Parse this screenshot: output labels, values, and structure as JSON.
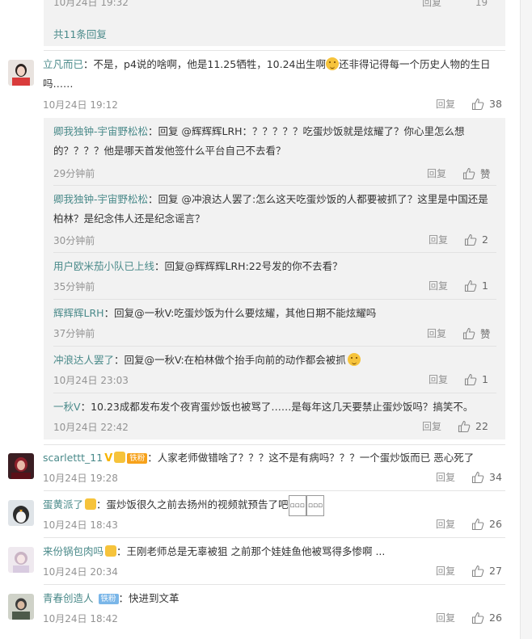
{
  "prev_thread": {
    "cut_time": "10月24日 19:32",
    "cut_reply": "回复",
    "cut_likes": "19",
    "more_replies": "共11条回复"
  },
  "comments": [
    {
      "name": "立凡而已",
      "text_a": "：不是，p4说的啥啊，他是11.25牺牲，10.24出生啊",
      "text_b": "还非得记得每一个历史人物的生日吗……",
      "time": "10月24日 19:12",
      "reply": "回复",
      "likes": "38",
      "replies": [
        {
          "name": "卿我独钟-宇宙野松松",
          "text": "：回复 @辉辉辉LRH：？？？？？吃蛋炒饭就是炫耀了？你心里怎么想的？？？？他是哪天首发他签什么平台自己不去看？",
          "time": "29分钟前",
          "reply": "回复",
          "likes": "赞"
        },
        {
          "name": "卿我独钟-宇宙野松松",
          "text": "：回复 @冲浪达人罢了:怎么这天吃蛋炒饭的人都要被抓了？这里是中国还是柏林？是纪念伟人还是纪念谣言？",
          "time": "30分钟前",
          "reply": "回复",
          "likes": "2"
        },
        {
          "name": "用户欧米茄小队已上线",
          "text": "：回复@辉辉辉LRH:22号发的你不去看？",
          "time": "35分钟前",
          "reply": "回复",
          "likes": "1"
        },
        {
          "name": "辉辉辉LRH",
          "text": "：回复@一秋V:吃蛋炒饭为什么要炫耀，其他日期不能炫耀吗",
          "time": "37分钟前",
          "reply": "回复",
          "likes": "赞"
        },
        {
          "name": "冲浪达人罢了",
          "text": "：回复@一秋V:在柏林做个抬手向前的动作都会被抓",
          "time": "10月24日 23:03",
          "reply": "回复",
          "likes": "1"
        },
        {
          "name": "一秋V",
          "text": "：10.23成都发布发个夜宵蛋炒饭也被骂了……是每年这几天要禁止蛋炒饭吗？搞笑不。",
          "time": "10月24日 22:42",
          "reply": "回复",
          "likes": "22"
        }
      ]
    },
    {
      "name": "scarlettt_11",
      "badge": "铁粉",
      "text": "：人家老师做错啥了？？？这不是有病吗？？？一个蛋炒饭而已 恶心死了",
      "time": "10月24日 19:28",
      "reply": "回复",
      "likes": "34"
    },
    {
      "name": "蛋黄派了",
      "text": "：蛋炒饭很久之前去扬州的视频就预告了吧",
      "time": "10月24日 18:43",
      "reply": "回复",
      "likes": "26"
    },
    {
      "name": "来份锅包肉吗",
      "text": "：王刚老师总是无辜被狙 之前那个娃娃鱼他被骂得多惨啊 ...",
      "time": "10月24日 20:34",
      "reply": "回复",
      "likes": "27"
    },
    {
      "name": "青春创造人",
      "badge": "铁粉",
      "text": "：快进到文革",
      "time": "10月24日 18:42",
      "reply": "回复",
      "likes": "26"
    }
  ],
  "colors": {
    "name": "#4a8a8a",
    "meta": "#939393",
    "reply_bg": "#f2f2f2"
  },
  "icons": {
    "like": "thumbs-up-icon",
    "emoji": "smiley-emoji-icon"
  }
}
